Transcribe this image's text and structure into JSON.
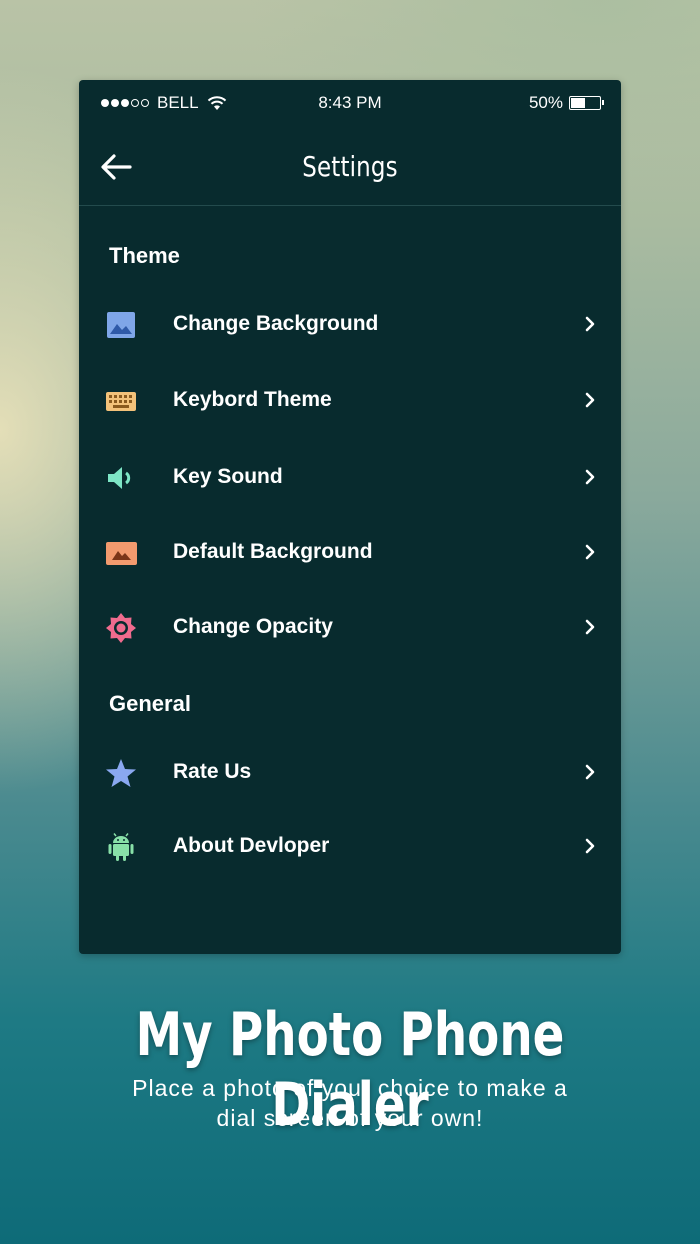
{
  "status_bar": {
    "carrier": "BELL",
    "time": "8:43 PM",
    "battery": "50%",
    "battery_level": 0.5,
    "signal_bars_filled": 3,
    "signal_bars_total": 5
  },
  "header": {
    "back_icon": "arrow-left-icon",
    "title": "Settings"
  },
  "sections": {
    "theme": "Theme",
    "general": "General"
  },
  "items": [
    {
      "label": "Change Background",
      "icon": "image-icon",
      "color": "#7fa6e8"
    },
    {
      "label": "Keybord Theme",
      "icon": "keyboard-icon",
      "color": "#f3c27a"
    },
    {
      "label": "Key Sound",
      "icon": "speaker-icon",
      "color": "#7ee6c6"
    },
    {
      "label": "Default Background",
      "icon": "landscape-icon",
      "color": "#f29a6e"
    },
    {
      "label": "Change Opacity",
      "icon": "brightness-icon",
      "color": "#f06b8e"
    },
    {
      "label": "Rate Us",
      "icon": "star-icon",
      "color": "#8aa8f0"
    },
    {
      "label": "About Devloper",
      "icon": "android-icon",
      "color": "#88e0a8"
    }
  ],
  "promo": {
    "headline": "My Photo Phone Dialer",
    "subtitle_line1": "Place a photo of your choice to make a",
    "subtitle_line2": "dial screen of your own!"
  }
}
